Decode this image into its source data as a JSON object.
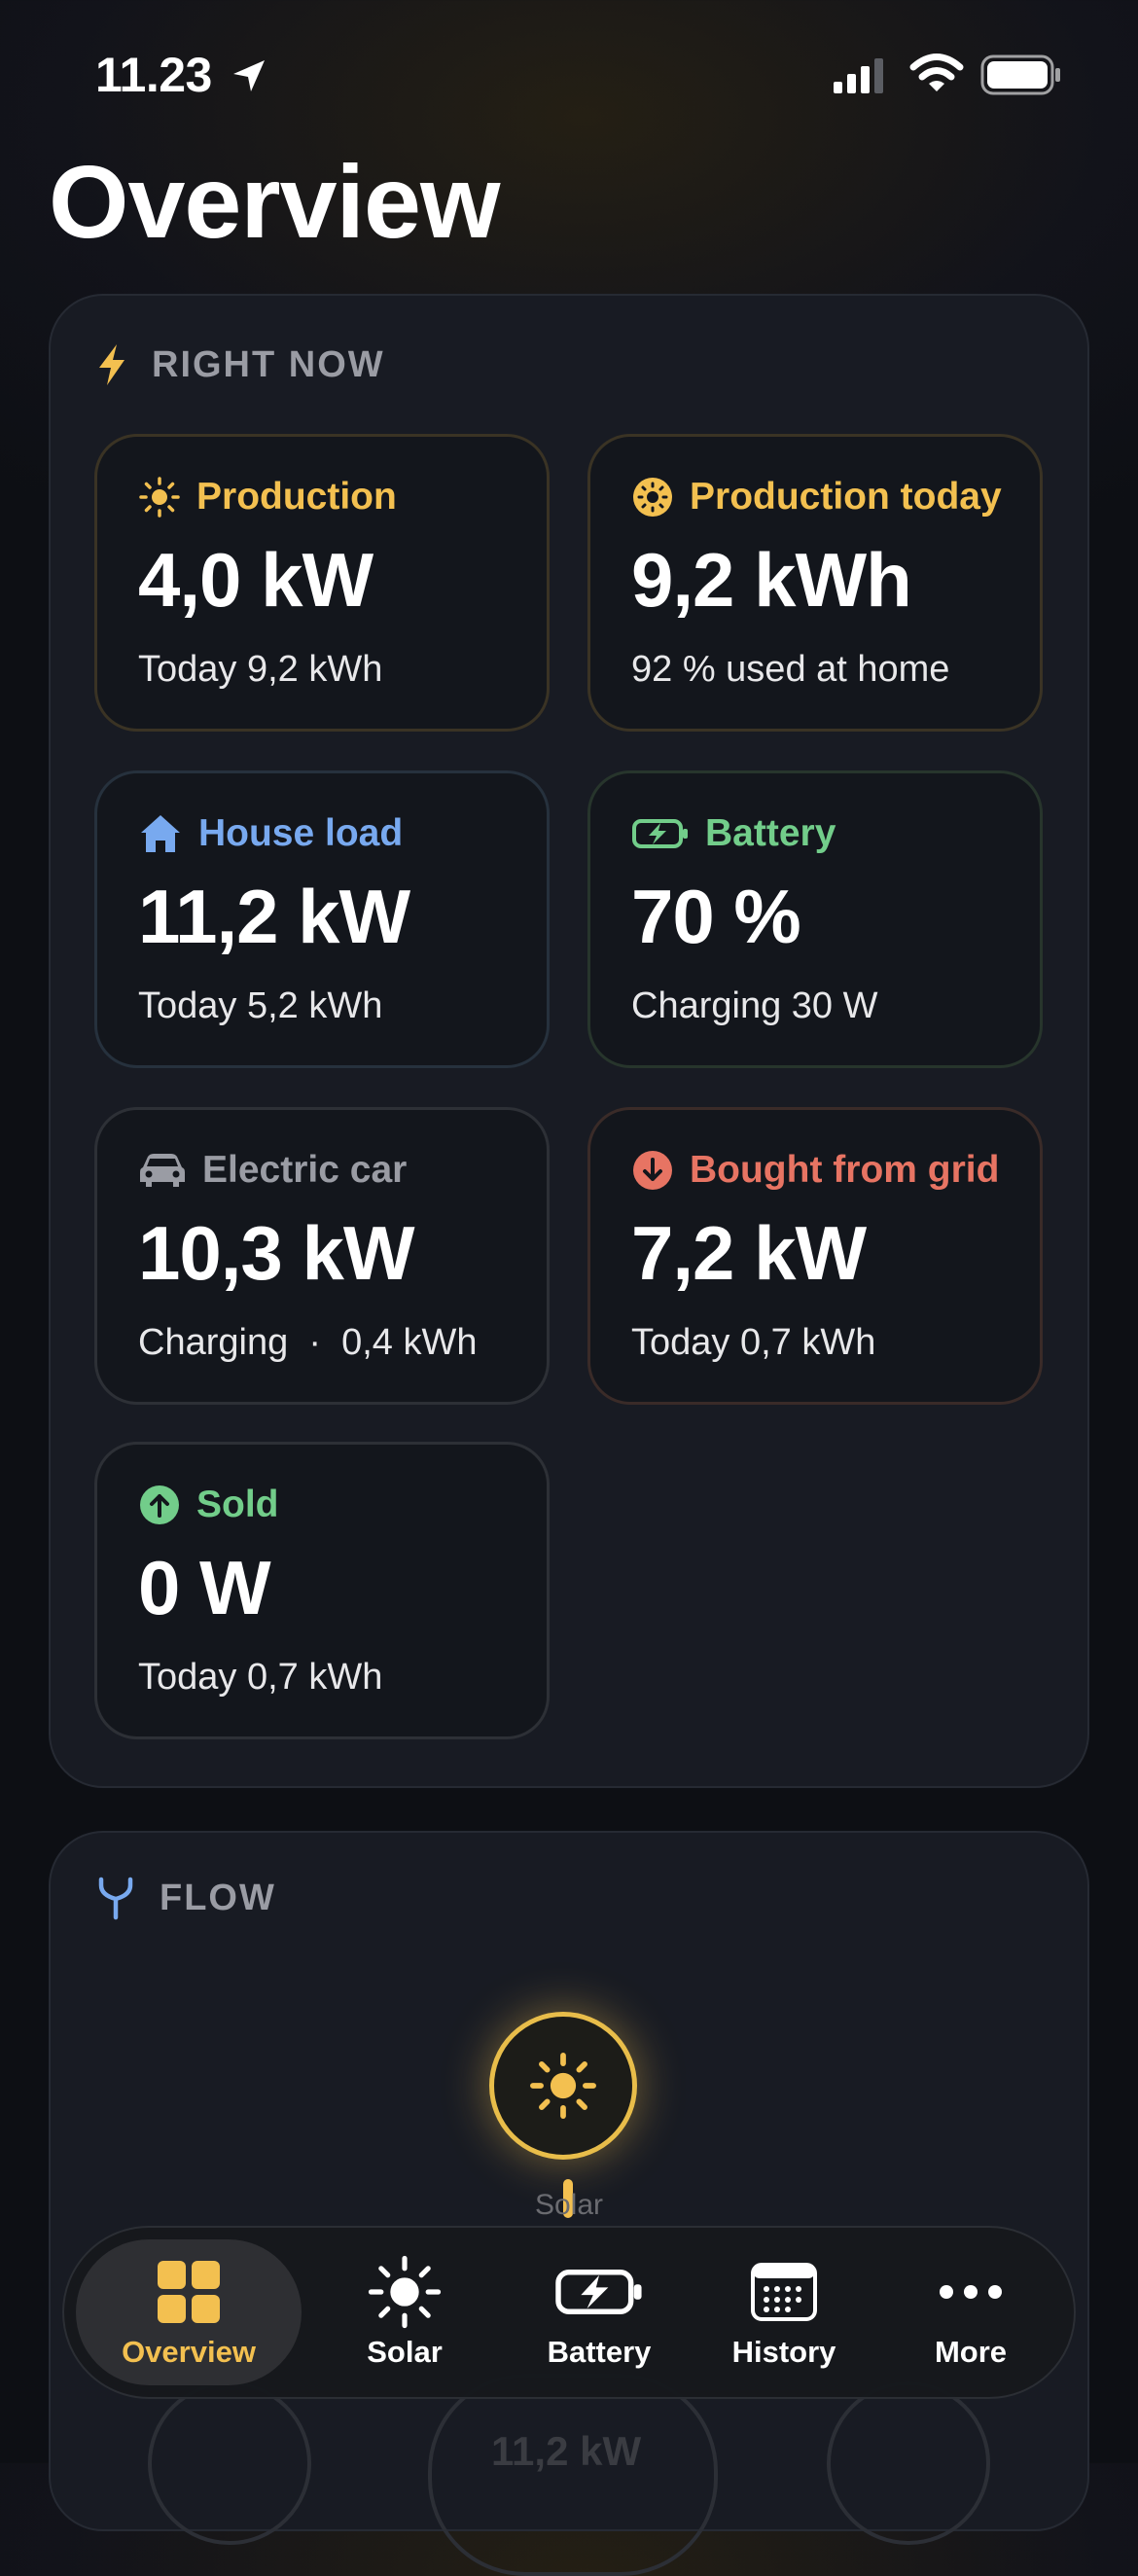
{
  "status_bar": {
    "time": "11.23"
  },
  "page": {
    "title": "Overview"
  },
  "right_now": {
    "label": "RIGHT NOW",
    "cards": [
      {
        "title": "Production",
        "value": "4,0 kW",
        "sub": "Today 9,2 kWh",
        "icon": "sun-icon",
        "color": "#f3c050"
      },
      {
        "title": "Production today",
        "value": "9,2 kWh",
        "sub": "92 % used at home",
        "icon": "sun-badge-icon",
        "color": "#f3c050"
      },
      {
        "title": "House load",
        "value": "11,2 kW",
        "sub": "Today 5,2 kWh",
        "icon": "house-icon",
        "color": "#78a9ef"
      },
      {
        "title": "Battery",
        "value": "70 %",
        "sub": "Charging 30 W",
        "icon": "battery-charging-icon",
        "color": "#72cd8a"
      },
      {
        "title": "Electric car",
        "value": "10,3 kW",
        "sub": "Charging  ·  0,4 kWh",
        "icon": "car-icon",
        "color": "#9a9ca4"
      },
      {
        "title": "Bought from grid",
        "value": "7,2 kW",
        "sub": "Today 0,7 kWh",
        "icon": "arrow-down-circle-icon",
        "color": "#e77463"
      },
      {
        "title": "Sold",
        "value": "0 W",
        "sub": "Today 0,7 kWh",
        "icon": "arrow-up-circle-icon",
        "color": "#72cd8a"
      }
    ]
  },
  "flow": {
    "label": "FLOW",
    "solar_node_label": "Solar",
    "house_value_partial": "11,2 kW"
  },
  "tabbar": {
    "tabs": [
      {
        "label": "Overview",
        "icon": "grid-icon",
        "active": true
      },
      {
        "label": "Solar",
        "icon": "sun-icon",
        "active": false
      },
      {
        "label": "Battery",
        "icon": "battery-charging-icon",
        "active": false
      },
      {
        "label": "History",
        "icon": "calendar-icon",
        "active": false
      },
      {
        "label": "More",
        "icon": "ellipsis-icon",
        "active": false
      }
    ]
  }
}
